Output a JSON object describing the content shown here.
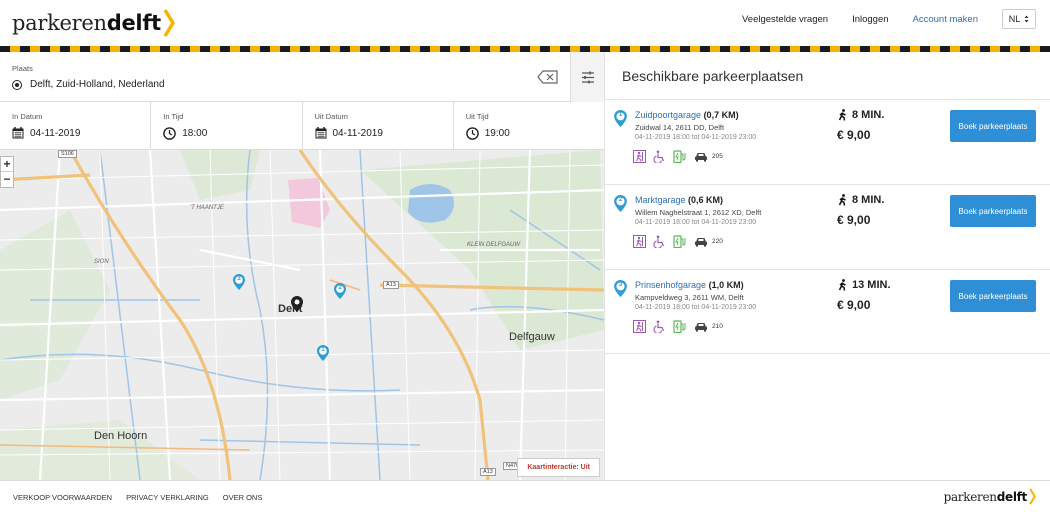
{
  "header": {
    "logo_part1": "parkeren",
    "logo_part2": "delft",
    "nav": [
      {
        "label": "Veelgestelde vragen"
      },
      {
        "label": "Inloggen"
      },
      {
        "label": "Account maken"
      }
    ],
    "language": "NL"
  },
  "search": {
    "place_label": "Plaats",
    "place_value": "Delft, Zuid-Holland, Nederland",
    "dates": [
      {
        "label": "In Datum",
        "value": "04-11-2019",
        "icon": "calendar-icon"
      },
      {
        "label": "In Tijd",
        "value": "18:00",
        "icon": "clock-icon"
      },
      {
        "label": "Uit Datum",
        "value": "04-11-2019",
        "icon": "calendar-icon"
      },
      {
        "label": "Uit Tijd",
        "value": "19:00",
        "icon": "clock-icon"
      }
    ]
  },
  "map": {
    "zoom_in": "+",
    "zoom_out": "−",
    "labels": {
      "haantje": "'T HAANTJE",
      "sion": "SION",
      "klein_delfgauw": "KLEIN DELFGAUW"
    },
    "cities": {
      "delft": "Delft",
      "delfgauw": "Delfgauw",
      "den_hoorn": "Den Hoorn"
    },
    "roads": {
      "s106": "S106",
      "a13_top": "A13",
      "a13_bottom": "A13",
      "n470": "N470"
    },
    "pin_numbers": [
      "1",
      "2",
      "3"
    ],
    "interaction_button": "Kaartinteractie: Uit"
  },
  "results": {
    "title": "Beschikbare parkeerplaatsen",
    "items": [
      {
        "number": "1",
        "name": "Zuidpoortgarage",
        "distance": "(0,7 KM)",
        "address": "Zuidwal 14, 2611 DD, Delft",
        "time": "04-11-2019 18:00 tot 04-11-2019 23:00",
        "spots": "205",
        "walk": "8 MIN.",
        "price": "€ 9,00",
        "button": "Boek parkeerplaats"
      },
      {
        "number": "2",
        "name": "Marktgarage",
        "distance": "(0,6 KM)",
        "address": "Willem Naghelstraat 1, 2612 XD, Delft",
        "time": "04-11-2019 18:00 tot 04-11-2019 23:00",
        "spots": "220",
        "walk": "8 MIN.",
        "price": "€ 9,00",
        "button": "Boek parkeerplaats"
      },
      {
        "number": "3",
        "name": "Prinsenhofgarage",
        "distance": "(1,0 KM)",
        "address": "Kampveldweg 3, 2611 WM, Delft",
        "time": "04-11-2019 18:00 tot 04-11-2019 23:00",
        "spots": "210",
        "walk": "13 MIN.",
        "price": "€ 9,00",
        "button": "Boek parkeerplaats"
      }
    ]
  },
  "footer": {
    "links": [
      {
        "label": "VERKOOP VOORWAARDEN"
      },
      {
        "label": "PRIVACY VERKLARING"
      },
      {
        "label": "OVER ONS"
      }
    ],
    "logo_part1": "parkeren",
    "logo_part2": "delft"
  },
  "colors": {
    "accent": "#2e8fd6",
    "link": "#2a6fb5",
    "brand_yellow": "#f5b400",
    "amenity_purple": "#9b59b6",
    "amenity_green": "#5cb85c"
  }
}
